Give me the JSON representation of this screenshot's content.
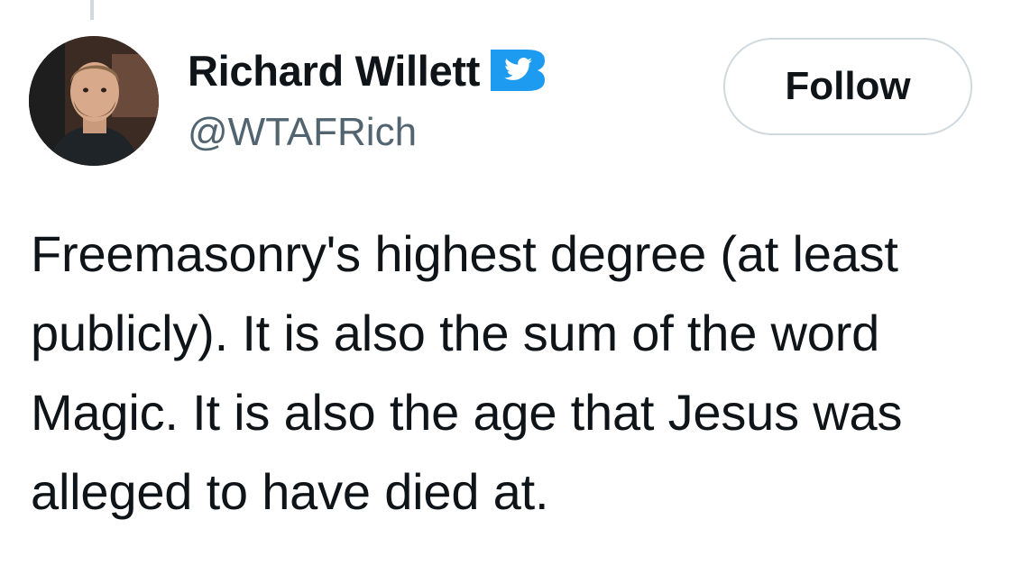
{
  "author": {
    "display_name": "Richard Willett",
    "handle": "@WTAFRich",
    "verified": true,
    "avatar_icon": "profile-photo"
  },
  "actions": {
    "follow_label": "Follow"
  },
  "tweet": {
    "lines": [
      "Freemasonry's highest degree (at least",
      "publicly). It is also the sum of the word",
      "Magic. It is also the age that Jesus was",
      "alleged to have died at."
    ]
  },
  "colors": {
    "brand_blue": "#1d9bf0",
    "text_primary": "#0f1419",
    "text_secondary": "#536471",
    "border": "#cfd9de"
  }
}
